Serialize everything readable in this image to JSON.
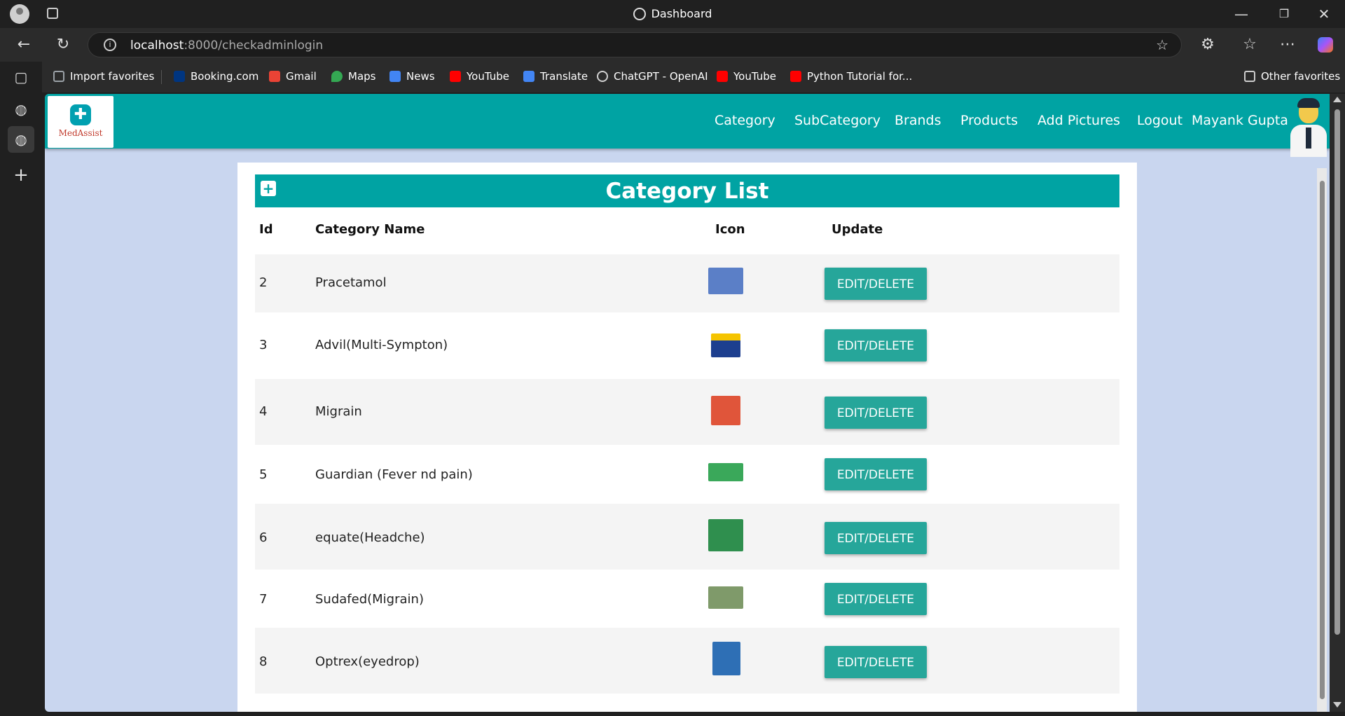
{
  "window": {
    "title": "Dashboard",
    "controls": {
      "minimize": "—",
      "restore": "❐",
      "close": "✕"
    }
  },
  "browser": {
    "url_host": "localhost",
    "url_path": ":8000/checkadminlogin",
    "bookmarks": [
      {
        "label": "Import favorites",
        "icon": "import-icon",
        "color": "#9aa0a6"
      },
      {
        "label": "Booking.com",
        "icon": "booking-icon",
        "color": "#003580"
      },
      {
        "label": "Gmail",
        "icon": "gmail-icon",
        "color": "#ea4335"
      },
      {
        "label": "Maps",
        "icon": "maps-icon",
        "color": "#34a853"
      },
      {
        "label": "News",
        "icon": "news-icon",
        "color": "#4285f4"
      },
      {
        "label": "YouTube",
        "icon": "youtube-icon",
        "color": "#ff0000"
      },
      {
        "label": "Translate",
        "icon": "translate-icon",
        "color": "#4285f4"
      },
      {
        "label": "ChatGPT - OpenAI",
        "icon": "chatgpt-icon",
        "color": "#d0d0d0"
      },
      {
        "label": "YouTube",
        "icon": "youtube-icon",
        "color": "#ff0000"
      },
      {
        "label": "Python Tutorial for...",
        "icon": "youtube-icon",
        "color": "#ff0000"
      }
    ],
    "other_favorites": "Other favorites"
  },
  "app": {
    "logo_text": "MedAssist",
    "nav": {
      "category": "Category",
      "subcategory": "SubCategory",
      "brands": "Brands",
      "products": "Products",
      "add_pictures": "Add Pictures",
      "logout": "Logout",
      "user": "Mayank Gupta"
    },
    "list_title": "Category List",
    "add_symbol": "+",
    "columns": {
      "id": "Id",
      "name": "Category Name",
      "icon": "Icon",
      "update": "Update"
    },
    "button_label": "EDIT/DELETE",
    "rows": [
      {
        "id": "2",
        "name": "Pracetamol",
        "icon_color": "#5b7fc7"
      },
      {
        "id": "3",
        "name": "Advil(Multi-Sympton)",
        "icon_color": "#1d3f8f"
      },
      {
        "id": "4",
        "name": "Migrain",
        "icon_color": "#e0553a"
      },
      {
        "id": "5",
        "name": "Guardian (Fever nd pain)",
        "icon_color": "#3aa85a"
      },
      {
        "id": "6",
        "name": "equate(Headche)",
        "icon_color": "#2f8f4e"
      },
      {
        "id": "7",
        "name": "Sudafed(Migrain)",
        "icon_color": "#7f9a6a"
      },
      {
        "id": "8",
        "name": "Optrex(eyedrop)",
        "icon_color": "#2e6fb5"
      }
    ],
    "colors": {
      "header": "#00a3a3",
      "button": "#26a69a",
      "page_bg": "#c9d6ef"
    }
  }
}
